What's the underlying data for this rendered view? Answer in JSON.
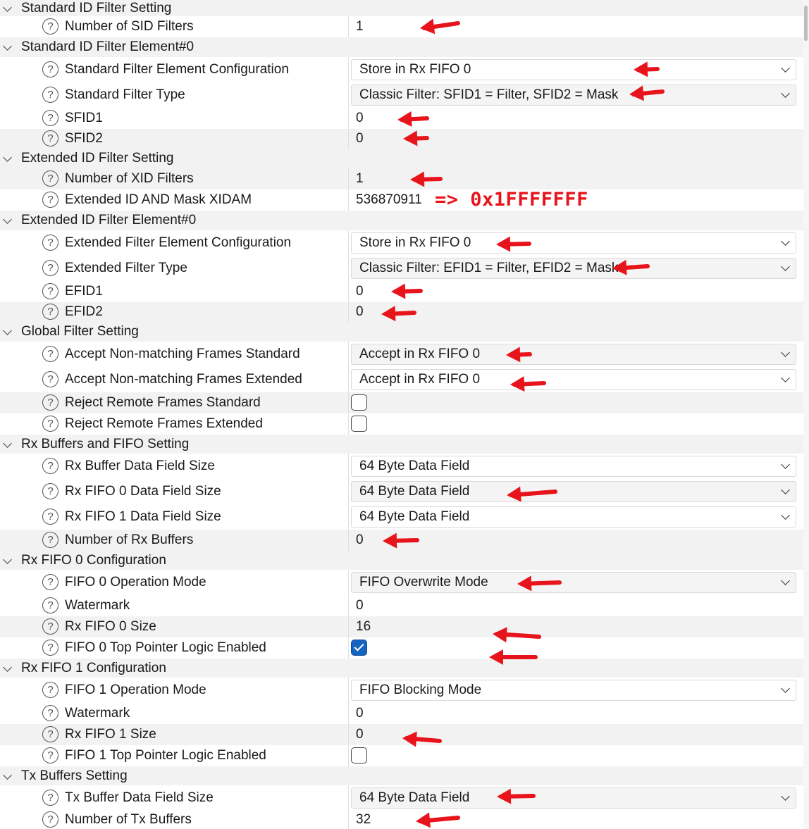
{
  "rows": [
    {
      "type": "section",
      "label": "Standard ID Filter Setting"
    },
    {
      "type": "text",
      "label": "Number of SID Filters",
      "value": "1"
    },
    {
      "type": "section",
      "label": "Standard ID Filter Element#0"
    },
    {
      "type": "dropdown",
      "label": "Standard Filter Element Configuration",
      "value": "Store in Rx FIFO 0"
    },
    {
      "type": "dropdown",
      "label": "Standard Filter Type",
      "value": "Classic Filter: SFID1 = Filter, SFID2 = Mask"
    },
    {
      "type": "text",
      "label": "SFID1",
      "value": "0"
    },
    {
      "type": "text",
      "label": "SFID2",
      "value": "0"
    },
    {
      "type": "section",
      "label": "Extended ID Filter Setting"
    },
    {
      "type": "text",
      "label": "Number of XID Filters",
      "value": "1"
    },
    {
      "type": "text",
      "label": "Extended ID AND Mask XIDAM",
      "value": "536870911"
    },
    {
      "type": "section",
      "label": "Extended ID Filter Element#0"
    },
    {
      "type": "dropdown",
      "label": "Extended Filter Element Configuration",
      "value": "Store in Rx FIFO 0"
    },
    {
      "type": "dropdown",
      "label": "Extended Filter Type",
      "value": "Classic Filter: EFID1 = Filter, EFID2 = Mask"
    },
    {
      "type": "text",
      "label": "EFID1",
      "value": "0"
    },
    {
      "type": "text",
      "label": "EFID2",
      "value": "0"
    },
    {
      "type": "section",
      "label": "Global Filter Setting"
    },
    {
      "type": "dropdown",
      "label": "Accept Non-matching Frames Standard",
      "value": "Accept in Rx FIFO 0"
    },
    {
      "type": "dropdown",
      "label": "Accept Non-matching Frames Extended",
      "value": "Accept in Rx FIFO 0"
    },
    {
      "type": "checkbox",
      "label": "Reject Remote Frames Standard",
      "checked": false
    },
    {
      "type": "checkbox",
      "label": "Reject Remote Frames Extended",
      "checked": false
    },
    {
      "type": "section",
      "label": "Rx Buffers and FIFO Setting"
    },
    {
      "type": "dropdown",
      "label": "Rx Buffer Data Field Size",
      "value": "64 Byte Data Field"
    },
    {
      "type": "dropdown",
      "label": "Rx FIFO 0 Data Field Size",
      "value": "64 Byte Data Field"
    },
    {
      "type": "dropdown",
      "label": "Rx FIFO 1 Data Field Size",
      "value": "64 Byte Data Field"
    },
    {
      "type": "text",
      "label": "Number of Rx Buffers",
      "value": "0"
    },
    {
      "type": "section",
      "label": "Rx FIFO 0 Configuration"
    },
    {
      "type": "dropdown",
      "label": "FIFO 0 Operation Mode",
      "value": "FIFO Overwrite Mode"
    },
    {
      "type": "text",
      "label": "Watermark",
      "value": "0"
    },
    {
      "type": "text",
      "label": "Rx FIFO 0 Size",
      "value": "16"
    },
    {
      "type": "checkbox",
      "label": "FIFO 0 Top Pointer Logic Enabled",
      "checked": true
    },
    {
      "type": "section",
      "label": "Rx FIFO 1 Configuration"
    },
    {
      "type": "dropdown",
      "label": "FIFO 1 Operation Mode",
      "value": "FIFO Blocking Mode"
    },
    {
      "type": "text",
      "label": "Watermark",
      "value": "0"
    },
    {
      "type": "text",
      "label": "Rx FIFO 1 Size",
      "value": "0"
    },
    {
      "type": "checkbox",
      "label": "FIFO 1 Top Pointer Logic Enabled",
      "checked": false
    },
    {
      "type": "section",
      "label": "Tx Buffers Setting"
    },
    {
      "type": "dropdown",
      "label": "Tx Buffer Data Field Size",
      "value": "64 Byte Data Field"
    },
    {
      "type": "text",
      "label": "Number of Tx Buffers",
      "value": "32"
    }
  ],
  "help_glyph": "?",
  "annotation": {
    "text": "=> 0x1FFFFFFF",
    "color": "#e8141b"
  },
  "colors": {
    "row_shade": "#f2f2f2",
    "checkbox_checked": "#1565c0",
    "arrow": "#e8141b"
  }
}
